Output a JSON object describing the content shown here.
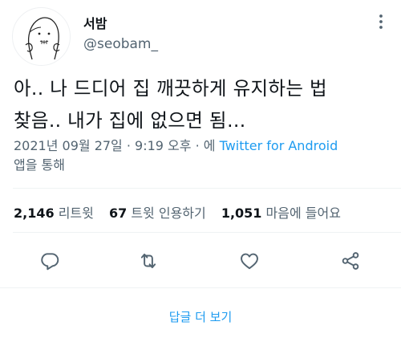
{
  "user": {
    "display_name": "서밤",
    "handle": "@seobam_"
  },
  "tweet": {
    "line1": "아..  나 드디어 집 깨끗하게 유지하는 법",
    "line2": "찾음..  내가 집에 없으면 됨…"
  },
  "meta": {
    "timestamp": "2021년 09월 27일 · 9:19 오후 · ",
    "via_prefix": "에 ",
    "source": "Twitter for Android",
    "via_suffix": "앱을 통해"
  },
  "stats": {
    "retweets_count": "2,146",
    "retweets_label": "리트윗",
    "quotes_count": "67",
    "quotes_label": "트윗 인용하기",
    "likes_count": "1,051",
    "likes_label": "마음에 들어요"
  },
  "actions": {
    "icons": [
      "reply-icon",
      "retweet-icon",
      "like-icon",
      "share-icon"
    ]
  },
  "replies": {
    "label": "답글 더 보기"
  },
  "colors": {
    "accent": "#1d9bf0",
    "secondary_text": "#536471",
    "primary_text": "#0f1419",
    "divider": "#eff3f4"
  }
}
